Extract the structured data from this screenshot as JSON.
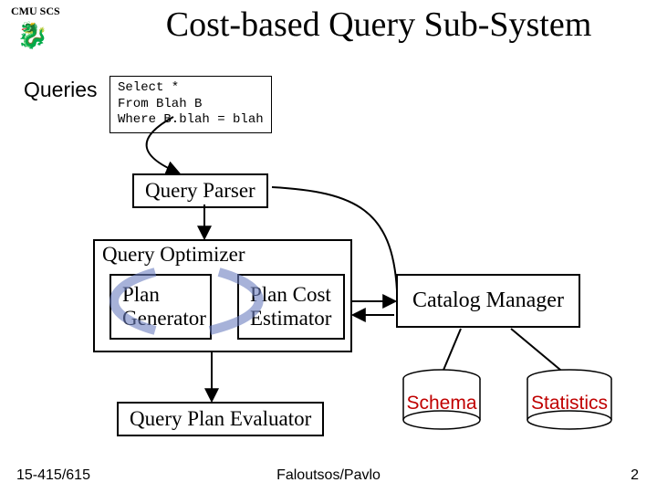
{
  "header": {
    "inst": "CMU SCS",
    "title": "Cost-based Query Sub-System"
  },
  "labels": {
    "queries": "Queries",
    "sql": "Select *\nFrom Blah B\nWhere B.blah = blah",
    "parser": "Query Parser",
    "optimizer": "Query Optimizer",
    "plan_gen": "Plan Generator",
    "plan_cost": "Plan Cost Estimator",
    "evaluator": "Query Plan Evaluator",
    "catalog": "Catalog Manager",
    "schema": "Schema",
    "stats": "Statistics"
  },
  "footer": {
    "left": "15-415/615",
    "center": "Faloutsos/Pavlo",
    "right": "2"
  }
}
